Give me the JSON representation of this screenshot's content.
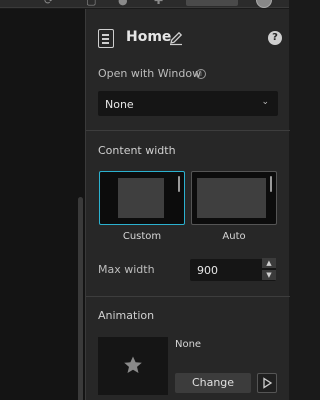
{
  "panel": {
    "title": "Home",
    "open_with_window_label": "Open with Window",
    "open_with_window_value": "None",
    "content_width_title": "Content width",
    "width_options": [
      {
        "label": "Custom",
        "selected": true
      },
      {
        "label": "Auto",
        "selected": false
      }
    ],
    "max_width_label": "Max width",
    "max_width_value": "900",
    "animation_title": "Animation",
    "animation_value": "None",
    "change_label": "Change"
  },
  "colors": {
    "accent": "#2bb1cf",
    "panel_bg": "#272727",
    "field_bg": "#151515"
  },
  "icons": [
    "page-icon",
    "edit-pencil-icon",
    "help-icon",
    "info-icon",
    "chevron-down-icon",
    "star-icon",
    "play-icon",
    "spin-up-icon",
    "spin-down-icon"
  ]
}
